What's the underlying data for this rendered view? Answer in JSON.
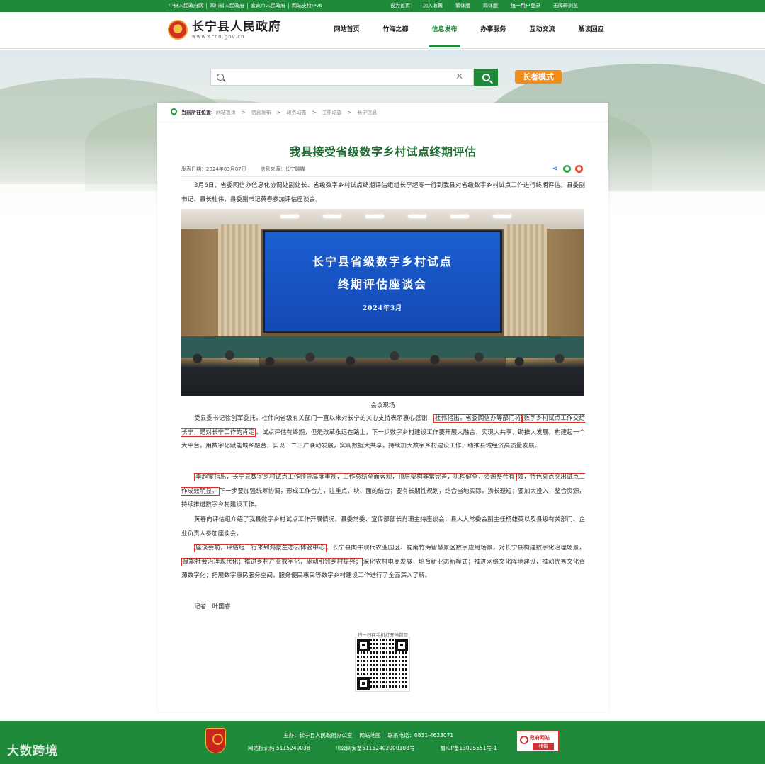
{
  "topbar": {
    "links": [
      "中央人民政府网",
      "四川省人民政府",
      "宜宾市人民政府",
      "网站支持IPv6"
    ],
    "right": [
      "设为首页",
      "加入收藏",
      "繁体版",
      "简体版",
      "统一用户登录",
      "无障碍浏览"
    ]
  },
  "header": {
    "site_title": "长宁县人民政府",
    "site_url": "www.sccn.gov.cn",
    "nav": [
      "网站首页",
      "竹海之都",
      "信息发布",
      "办事服务",
      "互动交流",
      "解读回应"
    ],
    "active_nav": "信息发布"
  },
  "search": {
    "clear_icon": "close-icon",
    "elder_mode": "长者模式"
  },
  "breadcrumb": {
    "label": "当前所在位置:",
    "items": [
      "网站首页",
      "信息发布",
      "政务动态",
      "工作动态",
      "长宁信息"
    ]
  },
  "article": {
    "title": "我县接受省级数字乡村试点终期评估",
    "date": "发表日期：2024年03月07日",
    "source": "信息来源：长宁融媒",
    "intro": "3月6日，省委网信办信息化协调处副处长、省级数字乡村试点终期评估组组长李超零一行到我县对省级数字乡村试点工作进行终期评估。县委副书记、县长杜伟，县委副书记黄春参加评估座谈会。",
    "photo": {
      "screen_line1": "长宁县省级数字乡村试点",
      "screen_line2": "终期评估座谈会",
      "screen_line3": "2024年3月"
    },
    "caption": "会议现场",
    "p2_a": "受县委书记徐创军委托，杜伟向省级有关部门一直以来对长宁的关心支持表示衷心感谢！",
    "p2_hl1": "杜伟指出，省委网信办等部门将",
    "p2_hl2": "数字乡村试点工作交给长宁，是对长宁工作的肯定",
    "p2_b": "。试点评估有终期，但是改革永远在路上，下一步数字乡村建设工作要开展大融合，实现大共享，助推大发展。构建起一个大平台，用数字化赋能城乡融合，实现一二三产联动发展，实现数据大共享，持续加大数字乡村建设工作，助推县域经济高质量发展。",
    "p3_hl1": "李超零指出，长宁县数字乡村试点工作领导高度重视，工作总结全面客观，顶层架构非常完善，机构健全，资源整合有",
    "p3_hl2": "效，特色亮点突出试点工作成效明显。",
    "p3_b": "下一步要加强统筹协调，形成工作合力，注重点、块、面的结合；要有长期性规划，结合当地实际，扬长避短；要加大投入，整合资源，持续推进数字乡村建设工作。",
    "p4": "黄春向评估组介绍了我县数字乡村试点工作开展情况。县委常委、宣传部部长肖珊主持座谈会，县人大常委会副主任杨雄英以及县级有关部门、企业负责人参加座谈会。",
    "p5_hl1": "座谈会前，评估组一行来到鸿蒙生态云体验中心",
    "p5_a": "、长宁县肉牛现代农业园区、蜀南竹海智慧景区数字应用场景，对长宁县构建数字化治理场景，",
    "p5_hl2": "赋能社会治理现代化；推进乡村产业数字化，驱动引领乡村振兴；",
    "p5_b": "深化农村电商发展，培育新业态新模式；推进网络文化阵地建设，推动优秀文化资源数字化；拓展数字惠民服务空间，服务便民惠民等数字乡村建设工作进行了全面深入了解。",
    "reporter": "记者：叶国睿",
    "qr_label": "扫一扫在手机打开当前页"
  },
  "footer": {
    "sponsor": "主办：长宁县人民政府办公室",
    "sitemap": "网站地图",
    "phone": "联系电话：0831-4623071",
    "site_code": "网站标识码 5115240038",
    "police": "川公网安备51152402000108号",
    "icp": "蜀ICP备13005551号-1",
    "badge_top": "政府网站",
    "badge_bottom": "找错"
  },
  "watermark": "大数跨境",
  "colors": {
    "brand_green": "#1e8a3a",
    "title_green": "#1e6a30",
    "highlight_red": "#e03128",
    "elder_orange": "#f08c1a"
  }
}
